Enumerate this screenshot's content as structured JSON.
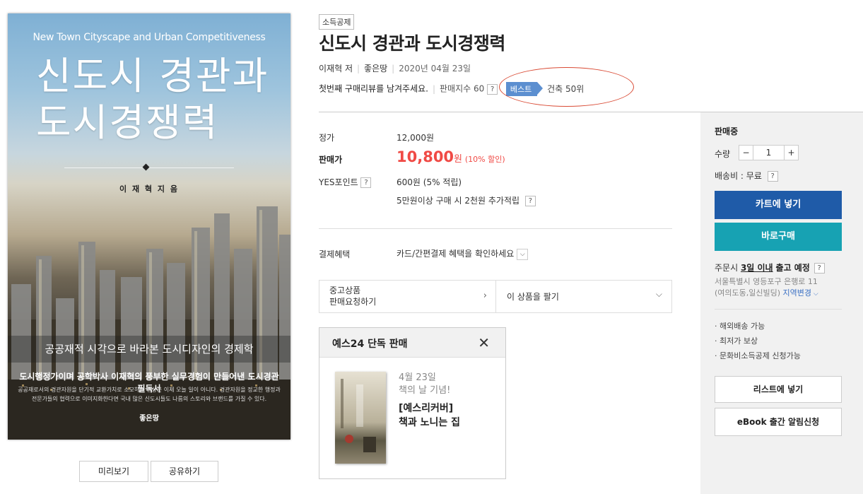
{
  "cover": {
    "en_title": "New Town Cityscape and Urban Competitiveness",
    "kr_title_line1": "신도시 경관과",
    "kr_title_line2": "도시경쟁력",
    "author": "이 재 혁  지 음",
    "banner": "공공재적 시각으로 바라본 도시디자인의 경제학",
    "tagline": "도시행정가이며 공학박사 이재혁의 풍부한 실무경험이 만들어낸 도시경관 필독서",
    "blurb": "공공재로서의 경관자원을 단기적 교환가치로 소모하는 현상은 이제 오늘 일이 아니다. 경관자원을 정교한 행정과 전문가들의 협력으로 이미지화한다면 국내 많은 신도시들도 나름의 스토리와 브랜드를 가질 수 있다.",
    "publisher": "좋은땅"
  },
  "cover_actions": {
    "preview": "미리보기",
    "share": "공유하기"
  },
  "product": {
    "tag": "소득공제",
    "title": "신도시 경관과 도시경쟁력",
    "author": "이재혁",
    "author_role": "저",
    "publisher": "좋은땅",
    "date": "2020년 04월 23일",
    "review_prompt": "첫번째 구매리뷰를 남겨주세요.",
    "sales_index_label": "판매지수 60",
    "best_badge": "베스트",
    "best_rank": "건축 50위"
  },
  "pricing": {
    "list_label": "정가",
    "list_price": "12,000원",
    "sale_label": "판매가",
    "sale_price": "10,800",
    "sale_won": "원",
    "discount": "(10% 할인)",
    "points_label": "YES포인트",
    "points_value": "600원 (5% 적립)",
    "points_extra": "5만원이상 구매 시 2천원 추가적립",
    "benefit_label": "결제혜택",
    "benefit_value": "카드/간편결제 혜택을 확인하세요"
  },
  "used": {
    "left_line1": "중고상품",
    "left_line2": "판매요청하기",
    "right": "이 상품을 팔기"
  },
  "exclusive": {
    "heading": "예스24 단독 판매",
    "date_line1": "4월 23일",
    "date_line2": "책의 날 기념!",
    "item_line1": "[예스리커버]",
    "item_line2": "책과 노니는 집"
  },
  "panel": {
    "status": "판매중",
    "qty_label": "수량",
    "qty_minus": "−",
    "qty_value": "1",
    "qty_plus": "+",
    "shipping": "배송비 : 무료",
    "cart": "카트에 넣기",
    "buy": "바로구매",
    "order_prefix": "주문시",
    "order_emph": "3일 이내",
    "order_suffix": "출고 예정",
    "address_line1": "서울특별시 영등포구 은행로 11",
    "address_line2": "(여의도동,일신빌딩)",
    "region_change": "지역변경",
    "features": [
      "· 해외배송 가능",
      "· 최저가 보상",
      "· 문화비소득공제 신청가능"
    ],
    "list_btn": "리스트에 넣기",
    "ebook_btn": "eBook 출간 알림신청"
  },
  "colors": {
    "sale_red": "#f04a45",
    "cart_blue": "#1f5ba8",
    "buy_teal": "#17a2b3",
    "best_blue": "#5c8fd0",
    "highlight_oval": "#d94a34"
  }
}
